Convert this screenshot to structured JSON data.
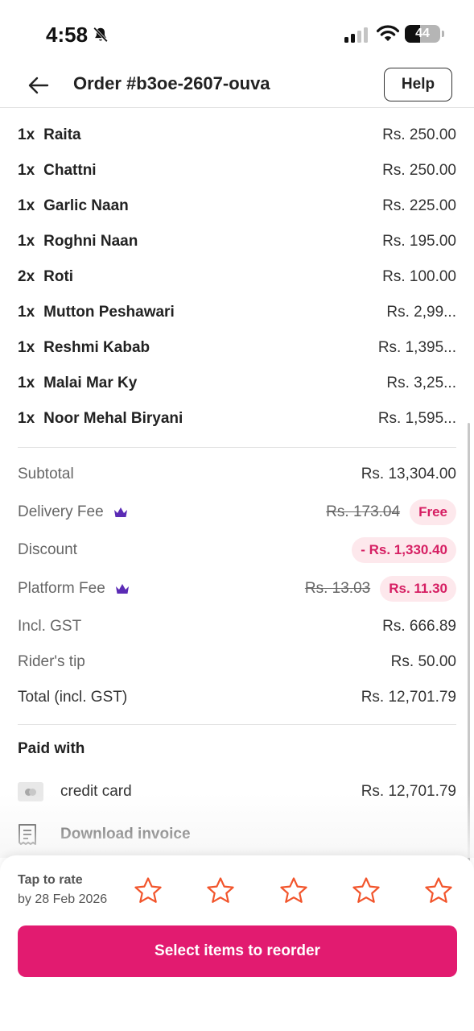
{
  "status_bar": {
    "time": "4:58",
    "battery": "44",
    "battery_level": 0.44,
    "icons": [
      "bell-muted-icon",
      "signal-icon",
      "wifi-icon",
      "battery-icon"
    ]
  },
  "header": {
    "title": "Order #b3oe-2607-ouva",
    "help_label": "Help"
  },
  "items": [
    {
      "qty": "1x",
      "name": "Raita",
      "price": "Rs. 250.00"
    },
    {
      "qty": "1x",
      "name": "Chattni",
      "price": "Rs. 250.00"
    },
    {
      "qty": "1x",
      "name": "Garlic Naan",
      "price": "Rs. 225.00"
    },
    {
      "qty": "1x",
      "name": "Roghni Naan",
      "price": "Rs. 195.00"
    },
    {
      "qty": "2x",
      "name": "Roti",
      "price": "Rs. 100.00"
    },
    {
      "qty": "1x",
      "name": "Mutton Peshawari",
      "price": "Rs. 2,99..."
    },
    {
      "qty": "1x",
      "name": "Reshmi Kabab",
      "price": "Rs. 1,395..."
    },
    {
      "qty": "1x",
      "name": "Malai Mar Ky",
      "price": "Rs. 3,25..."
    },
    {
      "qty": "1x",
      "name": "Noor Mehal Biryani",
      "price": "Rs. 1,595..."
    }
  ],
  "summary": {
    "subtotal": {
      "label": "Subtotal",
      "value": "Rs. 13,304.00"
    },
    "delivery_fee": {
      "label": "Delivery Fee",
      "original": "Rs. 173.04",
      "value": "Free"
    },
    "discount": {
      "label": "Discount",
      "value": "- Rs. 1,330.40"
    },
    "platform_fee": {
      "label": "Platform Fee",
      "original": "Rs. 13.03",
      "value": "Rs. 11.30"
    },
    "gst": {
      "label": "Incl. GST",
      "value": "Rs. 666.89"
    },
    "tip": {
      "label": "Rider's tip",
      "value": "Rs. 50.00"
    },
    "total": {
      "label": "Total (incl. GST)",
      "value": "Rs. 12,701.79"
    }
  },
  "payment": {
    "title": "Paid with",
    "method": "credit card",
    "amount": "Rs. 12,701.79",
    "invoice_label": "Download invoice"
  },
  "rating": {
    "title": "Tap to rate",
    "deadline": "by 28 Feb 2026",
    "stars": 5,
    "selected": 0
  },
  "reorder_label": "Select items to reorder",
  "colors": {
    "brand": "#e21b70",
    "pill_bg": "#fde8ec",
    "pill_text": "#d61f63",
    "crown": "#5b2bb5",
    "star": "#f2552c"
  }
}
